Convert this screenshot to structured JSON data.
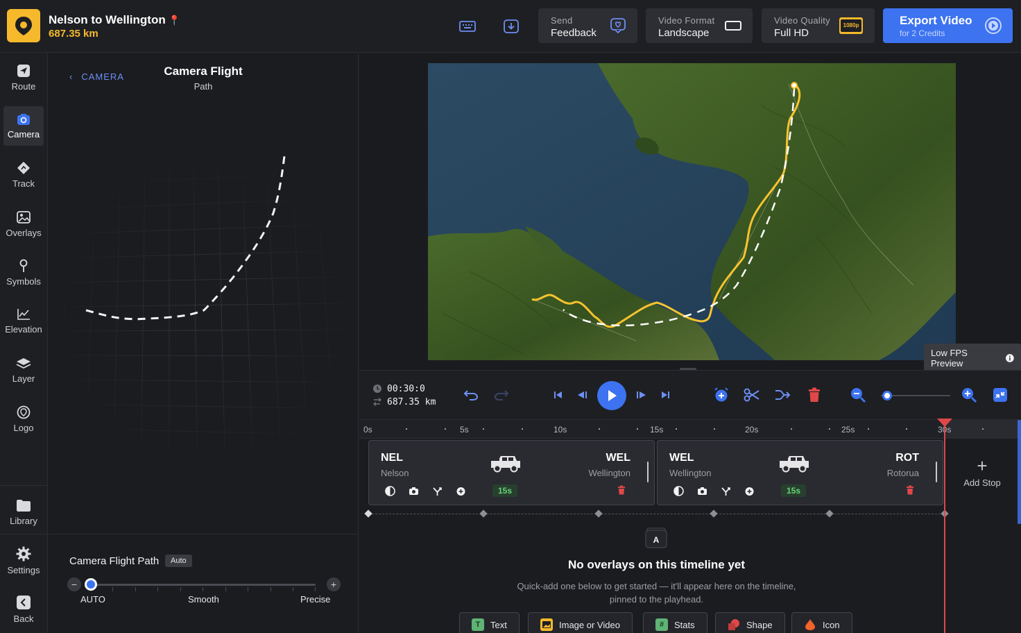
{
  "header": {
    "project_title": "Nelson to Wellington",
    "distance": "687.35 km",
    "send_feedback": {
      "small": "Send",
      "big": "Feedback"
    },
    "video_format": {
      "small": "Video Format",
      "big": "Landscape"
    },
    "video_quality": {
      "small": "Video Quality",
      "big": "Full HD",
      "badge": "1080p"
    },
    "export": {
      "big": "Export Video",
      "small": "for 2 Credits"
    }
  },
  "sidebar": {
    "items": [
      {
        "label": "Route",
        "icon": "route-icon"
      },
      {
        "label": "Camera",
        "icon": "camera-icon",
        "active": true
      },
      {
        "label": "Track",
        "icon": "track-icon"
      },
      {
        "label": "Overlays",
        "icon": "overlays-icon"
      },
      {
        "label": "Symbols",
        "icon": "symbols-icon"
      },
      {
        "label": "Elevation",
        "icon": "elevation-icon"
      },
      {
        "label": "Layer",
        "icon": "layer-icon"
      },
      {
        "label": "Logo",
        "icon": "logo-icon"
      }
    ],
    "bottom": [
      {
        "label": "Library",
        "icon": "folder-icon"
      },
      {
        "label": "Settings",
        "icon": "gear-icon"
      },
      {
        "label": "Back",
        "icon": "back-icon"
      }
    ]
  },
  "panel": {
    "back_label": "CAMERA",
    "title": "Camera Flight",
    "subtitle": "Path",
    "flight_path": {
      "title": "Camera Flight Path",
      "badge": "Auto",
      "labels": [
        "AUTO",
        "Smooth",
        "Precise"
      ],
      "value": "AUTO"
    }
  },
  "preview": {
    "fps_badge": "Low FPS Preview"
  },
  "transport": {
    "time": "00:30:0",
    "distance": "687.35 km",
    "zoom_level": 0.05
  },
  "timeline": {
    "ruler": [
      "0s",
      "5s",
      "10s",
      "15s",
      "20s",
      "25s",
      "30s"
    ],
    "segments": [
      {
        "from_code": "NEL",
        "from_name": "Nelson",
        "to_code": "WEL",
        "to_name": "Wellington",
        "duration": "15s"
      },
      {
        "from_code": "WEL",
        "from_name": "Wellington",
        "to_code": "ROT",
        "to_name": "Rotorua",
        "duration": "15s"
      }
    ],
    "add_stop": "Add Stop",
    "empty": {
      "icon_letter": "A",
      "title": "No overlays on this timeline yet",
      "desc_line1": "Quick-add one below to get started — it'll appear here on the timeline,",
      "desc_line2": "pinned to the playhead."
    },
    "quick_add": [
      "Text",
      "Image or Video",
      "Stats",
      "Shape",
      "Icon"
    ]
  },
  "colors": {
    "accent": "#3d73f0",
    "brand": "#f6b92c",
    "playhead": "#e04848",
    "duration": "#6ad27c"
  }
}
